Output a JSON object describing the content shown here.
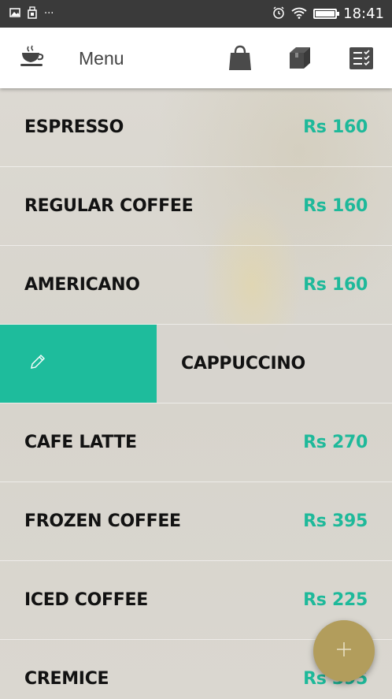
{
  "status_bar": {
    "left_icons": [
      "image-icon",
      "usb-icon",
      "more-dots-icon"
    ],
    "dots": "···",
    "time": "18:41"
  },
  "app_bar": {
    "title": "Menu",
    "icons": [
      "coffee-cup-icon",
      "shopping-bag-icon",
      "package-box-icon",
      "checklist-icon"
    ]
  },
  "menu": {
    "items": [
      {
        "name": "ESPRESSO",
        "price": "Rs 160"
      },
      {
        "name": "REGULAR COFFEE",
        "price": "Rs 160"
      },
      {
        "name": "AMERICANO",
        "price": "Rs 160"
      },
      {
        "name": "CAPPUCCINO",
        "price": ""
      },
      {
        "name": "CAFE LATTE",
        "price": "Rs 270"
      },
      {
        "name": "FROZEN COFFEE",
        "price": "Rs 395"
      },
      {
        "name": "ICED COFFEE",
        "price": "Rs 225"
      },
      {
        "name": "CREMICE",
        "price": "Rs 395"
      }
    ],
    "swiped_index": 3,
    "swipe_action_icon": "pencil-edit-icon"
  },
  "fab": {
    "icon": "plus-icon"
  },
  "colors": {
    "accent": "#1eb99a",
    "swipe_action_bg": "#1ebc9c",
    "fab": "#b29d5c",
    "status_bar": "#3a3a3a"
  }
}
